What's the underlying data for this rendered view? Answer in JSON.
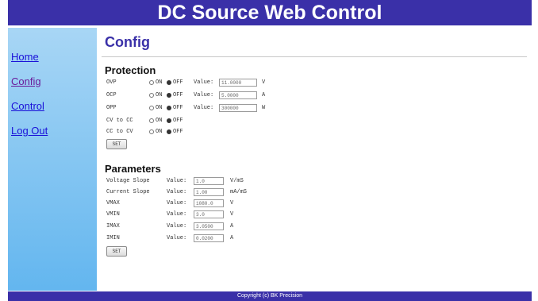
{
  "header": {
    "title": "DC Source Web Control"
  },
  "nav": {
    "home": "Home",
    "config": "Config",
    "control": "Control",
    "logout": "Log Out"
  },
  "page": {
    "title": "Config"
  },
  "protection": {
    "title": "Protection",
    "on_label": "ON",
    "off_label": "OFF",
    "value_label": "Value:",
    "rows": [
      {
        "label": "OVP",
        "selected": "off",
        "value": "11.0000",
        "unit": "V"
      },
      {
        "label": "OCP",
        "selected": "off",
        "value": "5.0000",
        "unit": "A"
      },
      {
        "label": "OPP",
        "selected": "off",
        "value": "300000",
        "unit": "W"
      },
      {
        "label": "CV to CC",
        "selected": "off"
      },
      {
        "label": "CC to CV",
        "selected": "off"
      }
    ],
    "set_label": "SET"
  },
  "parameters": {
    "title": "Parameters",
    "value_label": "Value:",
    "rows": [
      {
        "label": "Voltage Slope",
        "value": "1.0",
        "unit": "V/mS"
      },
      {
        "label": "Current Slope",
        "value": "1.00",
        "unit": "mA/mS"
      },
      {
        "label": "VMAX",
        "value": "1080.0",
        "unit": "V"
      },
      {
        "label": "VMIN",
        "value": "3.0",
        "unit": "V"
      },
      {
        "label": "IMAX",
        "value": "3.0500",
        "unit": "A"
      },
      {
        "label": "IMIN",
        "value": "0.0200",
        "unit": "A"
      }
    ],
    "set_label": "SET"
  },
  "footer": {
    "text": "Copyright (c) BK Precision"
  },
  "colors": {
    "brand": "#3a30a8",
    "sidebar_top": "#a8d6f5",
    "sidebar_bottom": "#63b6ef",
    "link": "#1a10d8",
    "visited": "#6a1b9a"
  }
}
